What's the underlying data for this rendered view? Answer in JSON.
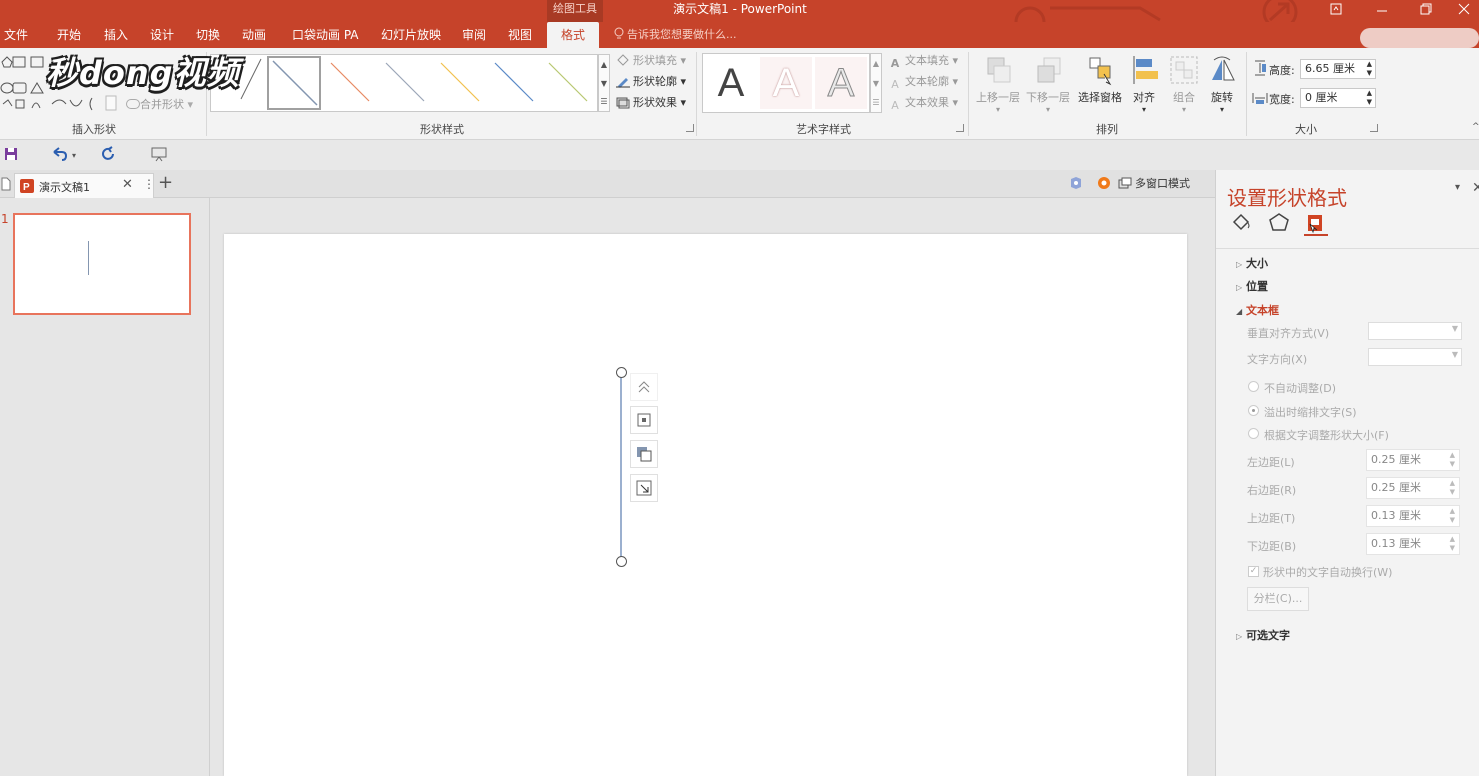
{
  "app": {
    "window_title": "演示文稿1 - PowerPoint",
    "contextual_group": "绘图工具"
  },
  "ribbon_tabs": [
    "文件",
    "开始",
    "插入",
    "设计",
    "切换",
    "动画",
    "口袋动画 PA",
    "幻灯片放映",
    "审阅",
    "视图",
    "格式"
  ],
  "active_tab": "格式",
  "tell_me": "告诉我您想要做什么...",
  "groups": {
    "insert_shapes": {
      "label": "插入形状",
      "merge_shapes": "合并形状"
    },
    "shape_styles": {
      "label": "形状样式",
      "fill": "形状填充",
      "outline": "形状轮廓",
      "effects": "形状效果"
    },
    "wordart_styles": {
      "label": "艺术字样式",
      "glyph": "A",
      "text_fill": "文本填充",
      "text_outline": "文本轮廓",
      "text_effects": "文本效果"
    },
    "arrange": {
      "label": "排列",
      "bring_forward": "上移一层",
      "send_backward": "下移一层",
      "selection_pane": "选择窗格",
      "align": "对齐",
      "group": "组合",
      "rotate": "旋转"
    },
    "size": {
      "label": "大小",
      "height_label": "高度:",
      "height_value": "6.65 厘米",
      "width_label": "宽度:",
      "width_value": "0 厘米"
    }
  },
  "doc_tab": {
    "name": "演示文稿1",
    "multi_window": "多窗口模式"
  },
  "thumbnails": [
    {
      "number": "1"
    }
  ],
  "format_pane": {
    "title": "设置形状格式",
    "sections": {
      "size": "大小",
      "position": "位置",
      "textbox": "文本框",
      "alt_text": "可选文字"
    },
    "vertical_align_label": "垂直对齐方式(V)",
    "text_direction_label": "文字方向(X)",
    "autofit_options": [
      "不自动调整(D)",
      "溢出时缩排文字(S)",
      "根据文字调整形状大小(F)"
    ],
    "margins": [
      {
        "label": "左边距(L)",
        "value": "0.25 厘米"
      },
      {
        "label": "右边距(R)",
        "value": "0.25 厘米"
      },
      {
        "label": "上边距(T)",
        "value": "0.13 厘米"
      },
      {
        "label": "下边距(B)",
        "value": "0.13 厘米"
      }
    ],
    "wrap_text": "形状中的文字自动换行(W)",
    "columns_button": "分栏(C)..."
  },
  "watermark": "秒dong视频",
  "colors": {
    "accent": "#c6432a",
    "ribbon_bg": "#f3f3f3"
  }
}
